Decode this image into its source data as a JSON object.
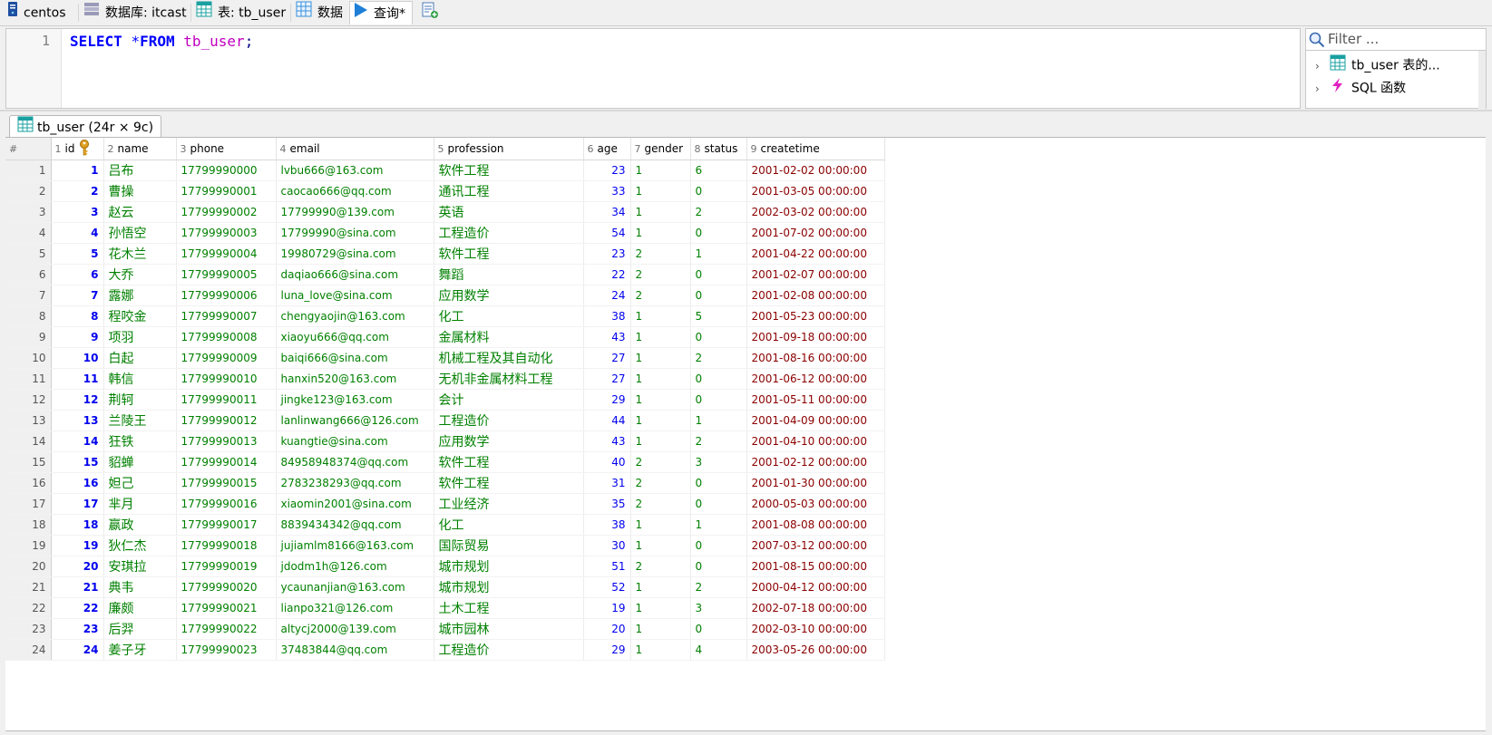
{
  "tabs": [
    {
      "label": "centos",
      "icon": "server-icon"
    },
    {
      "label": "数据库: itcast",
      "icon": "database-icon"
    },
    {
      "label": "表: tb_user",
      "icon": "table-icon"
    },
    {
      "label": "数据",
      "icon": "grid-icon"
    },
    {
      "label": "查询*",
      "icon": "play-icon"
    }
  ],
  "editor": {
    "line_number": "1",
    "sql": {
      "select": "SELECT",
      "star": "*",
      "from": "FROM",
      "table": "tb_user",
      "semicolon": ";"
    }
  },
  "helper": {
    "filter_placeholder": "Filter ...",
    "items": [
      {
        "label": "tb_user 表的...",
        "icon": "table-icon"
      },
      {
        "label": "SQL 函数",
        "icon": "lightning-icon"
      }
    ]
  },
  "result_tab": {
    "label": "tb_user (24r × 9c)"
  },
  "columns": [
    {
      "num": "#",
      "name": ""
    },
    {
      "num": "1",
      "name": "id"
    },
    {
      "num": "2",
      "name": "name"
    },
    {
      "num": "3",
      "name": "phone"
    },
    {
      "num": "4",
      "name": "email"
    },
    {
      "num": "5",
      "name": "profession"
    },
    {
      "num": "6",
      "name": "age"
    },
    {
      "num": "7",
      "name": "gender"
    },
    {
      "num": "8",
      "name": "status"
    },
    {
      "num": "9",
      "name": "createtime"
    }
  ],
  "rows": [
    [
      "1",
      "吕布",
      "17799990000",
      "lvbu666@163.com",
      "软件工程",
      "23",
      "1",
      "6",
      "2001-02-02 00:00:00"
    ],
    [
      "2",
      "曹操",
      "17799990001",
      "caocao666@qq.com",
      "通讯工程",
      "33",
      "1",
      "0",
      "2001-03-05 00:00:00"
    ],
    [
      "3",
      "赵云",
      "17799990002",
      "17799990@139.com",
      "英语",
      "34",
      "1",
      "2",
      "2002-03-02 00:00:00"
    ],
    [
      "4",
      "孙悟空",
      "17799990003",
      "17799990@sina.com",
      "工程造价",
      "54",
      "1",
      "0",
      "2001-07-02 00:00:00"
    ],
    [
      "5",
      "花木兰",
      "17799990004",
      "19980729@sina.com",
      "软件工程",
      "23",
      "2",
      "1",
      "2001-04-22 00:00:00"
    ],
    [
      "6",
      "大乔",
      "17799990005",
      "daqiao666@sina.com",
      "舞蹈",
      "22",
      "2",
      "0",
      "2001-02-07 00:00:00"
    ],
    [
      "7",
      "露娜",
      "17799990006",
      "luna_love@sina.com",
      "应用数学",
      "24",
      "2",
      "0",
      "2001-02-08 00:00:00"
    ],
    [
      "8",
      "程咬金",
      "17799990007",
      "chengyaojin@163.com",
      "化工",
      "38",
      "1",
      "5",
      "2001-05-23 00:00:00"
    ],
    [
      "9",
      "项羽",
      "17799990008",
      "xiaoyu666@qq.com",
      "金属材料",
      "43",
      "1",
      "0",
      "2001-09-18 00:00:00"
    ],
    [
      "10",
      "白起",
      "17799990009",
      "baiqi666@sina.com",
      "机械工程及其自动化",
      "27",
      "1",
      "2",
      "2001-08-16 00:00:00"
    ],
    [
      "11",
      "韩信",
      "17799990010",
      "hanxin520@163.com",
      "无机非金属材料工程",
      "27",
      "1",
      "0",
      "2001-06-12 00:00:00"
    ],
    [
      "12",
      "荆轲",
      "17799990011",
      "jingke123@163.com",
      "会计",
      "29",
      "1",
      "0",
      "2001-05-11 00:00:00"
    ],
    [
      "13",
      "兰陵王",
      "17799990012",
      "lanlinwang666@126.com",
      "工程造价",
      "44",
      "1",
      "1",
      "2001-04-09 00:00:00"
    ],
    [
      "14",
      "狂铁",
      "17799990013",
      "kuangtie@sina.com",
      "应用数学",
      "43",
      "1",
      "2",
      "2001-04-10 00:00:00"
    ],
    [
      "15",
      "貂蝉",
      "17799990014",
      "84958948374@qq.com",
      "软件工程",
      "40",
      "2",
      "3",
      "2001-02-12 00:00:00"
    ],
    [
      "16",
      "妲己",
      "17799990015",
      "2783238293@qq.com",
      "软件工程",
      "31",
      "2",
      "0",
      "2001-01-30 00:00:00"
    ],
    [
      "17",
      "芈月",
      "17799990016",
      "xiaomin2001@sina.com",
      "工业经济",
      "35",
      "2",
      "0",
      "2000-05-03 00:00:00"
    ],
    [
      "18",
      "嬴政",
      "17799990017",
      "8839434342@qq.com",
      "化工",
      "38",
      "1",
      "1",
      "2001-08-08 00:00:00"
    ],
    [
      "19",
      "狄仁杰",
      "17799990018",
      "jujiamlm8166@163.com",
      "国际贸易",
      "30",
      "1",
      "0",
      "2007-03-12 00:00:00"
    ],
    [
      "20",
      "安琪拉",
      "17799990019",
      "jdodm1h@126.com",
      "城市规划",
      "51",
      "2",
      "0",
      "2001-08-15 00:00:00"
    ],
    [
      "21",
      "典韦",
      "17799990020",
      "ycaunanjian@163.com",
      "城市规划",
      "52",
      "1",
      "2",
      "2000-04-12 00:00:00"
    ],
    [
      "22",
      "廉颇",
      "17799990021",
      "lianpo321@126.com",
      "土木工程",
      "19",
      "1",
      "3",
      "2002-07-18 00:00:00"
    ],
    [
      "23",
      "后羿",
      "17799990022",
      "altycj2000@139.com",
      "城市园林",
      "20",
      "1",
      "0",
      "2002-03-10 00:00:00"
    ],
    [
      "24",
      "姜子牙",
      "17799990023",
      "37483844@qq.com",
      "工程造价",
      "29",
      "1",
      "4",
      "2003-05-26 00:00:00"
    ]
  ]
}
